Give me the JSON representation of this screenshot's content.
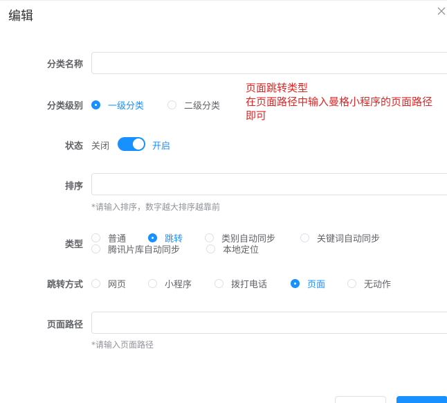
{
  "dialog": {
    "title": "编辑"
  },
  "form": {
    "category_name": {
      "label": "分类名称",
      "value": ""
    },
    "category_level": {
      "label": "分类级别",
      "options": [
        {
          "label": "一级分类",
          "checked": true
        },
        {
          "label": "二级分类",
          "checked": false
        }
      ]
    },
    "note": {
      "line1": "页面跳转类型",
      "line2": "在页面路径中输入曼格小程序的页面路径",
      "line3": "即可"
    },
    "status": {
      "label": "状态",
      "off_text": "关闭",
      "on_text": "开启",
      "enabled": true
    },
    "sort": {
      "label": "排序",
      "value": "",
      "hint": "*请输入排序，数字越大排序越靠前"
    },
    "type": {
      "label": "类型",
      "options": [
        {
          "label": "普通",
          "checked": false
        },
        {
          "label": "跳转",
          "checked": true
        },
        {
          "label": "类别自动同步",
          "checked": false
        },
        {
          "label": "关键词自动同步",
          "checked": false
        },
        {
          "label": "腾讯片库自动同步",
          "checked": false
        },
        {
          "label": "本地定位",
          "checked": false
        }
      ]
    },
    "jump_mode": {
      "label": "跳转方式",
      "options": [
        {
          "label": "网页",
          "checked": false
        },
        {
          "label": "小程序",
          "checked": false
        },
        {
          "label": "拨打电话",
          "checked": false
        },
        {
          "label": "页面",
          "checked": true
        },
        {
          "label": "无动作",
          "checked": false
        }
      ]
    },
    "page_path": {
      "label": "页面路径",
      "value": "",
      "hint": "*请输入页面路径"
    }
  },
  "colors": {
    "primary": "#1890ff",
    "note_red": "#e02424",
    "text": "#606266",
    "hint": "#909399"
  },
  "icons": {
    "close": "close-icon"
  }
}
